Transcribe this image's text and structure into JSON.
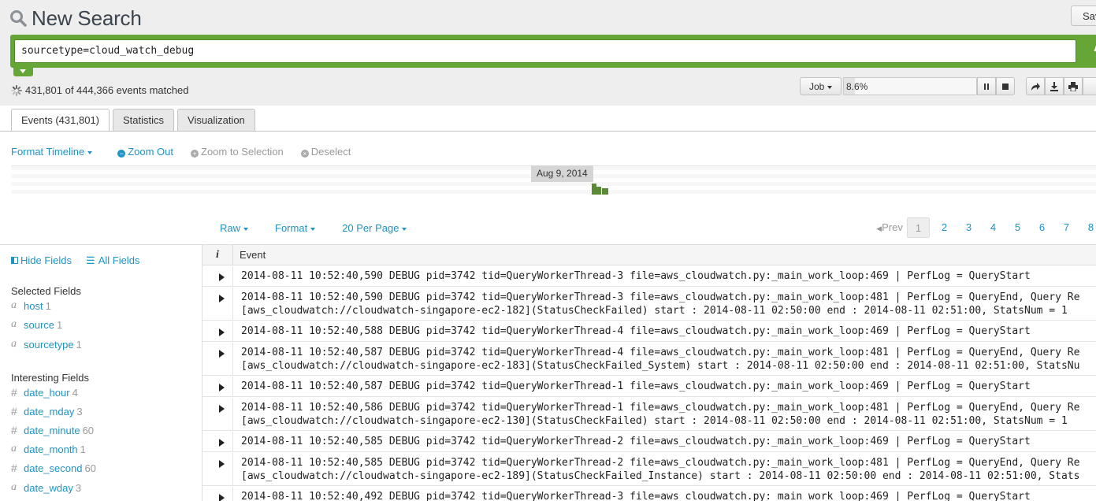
{
  "header": {
    "title": "New Search",
    "save_label": "Sav",
    "search_icon": "magnifier-icon"
  },
  "search": {
    "query": "sourcetype=cloud_watch_debug",
    "go_label": "A"
  },
  "status": {
    "matched_text": "431,801 of 444,366 events matched"
  },
  "job": {
    "label": "Job",
    "progress_text": "8.6%",
    "progress_fraction": 0.086,
    "controls": [
      "pause-icon",
      "stop-icon",
      "share-icon",
      "export-icon",
      "print-icon"
    ]
  },
  "tabs": [
    {
      "label": "Events (431,801)",
      "active": true
    },
    {
      "label": "Statistics",
      "active": false
    },
    {
      "label": "Visualization",
      "active": false
    }
  ],
  "timeline": {
    "format_label": "Format Timeline",
    "zoom_out": "Zoom Out",
    "zoom_selection": "Zoom to Selection",
    "deselect": "Deselect",
    "date_label": "Aug 9, 2014"
  },
  "results": {
    "raw_label": "Raw",
    "format_label": "Format",
    "per_page_label": "20 Per Page",
    "prev_label": "Prev",
    "pages": [
      "1",
      "2",
      "3",
      "4",
      "5",
      "6",
      "7",
      "8"
    ],
    "current_page": "1"
  },
  "sidebar": {
    "hide_fields": "Hide Fields",
    "all_fields": "All Fields",
    "selected_title": "Selected Fields",
    "selected_fields": [
      {
        "type": "a",
        "name": "host",
        "count": "1"
      },
      {
        "type": "a",
        "name": "source",
        "count": "1"
      },
      {
        "type": "a",
        "name": "sourcetype",
        "count": "1"
      }
    ],
    "interesting_title": "Interesting Fields",
    "interesting_fields": [
      {
        "type": "#",
        "name": "date_hour",
        "count": "4"
      },
      {
        "type": "#",
        "name": "date_mday",
        "count": "3"
      },
      {
        "type": "#",
        "name": "date_minute",
        "count": "60"
      },
      {
        "type": "a",
        "name": "date_month",
        "count": "1"
      },
      {
        "type": "#",
        "name": "date_second",
        "count": "60"
      },
      {
        "type": "a",
        "name": "date_wday",
        "count": "3"
      }
    ]
  },
  "events": {
    "info_header": "i",
    "event_header": "Event",
    "rows": [
      {
        "lines": [
          "2014-08-11 10:52:40,590 DEBUG pid=3742 tid=QueryWorkerThread-3 file=aws_cloudwatch.py:_main_work_loop:469 | PerfLog = QueryStart"
        ]
      },
      {
        "lines": [
          "2014-08-11 10:52:40,590 DEBUG pid=3742 tid=QueryWorkerThread-3 file=aws_cloudwatch.py:_main_work_loop:481 | PerfLog = QueryEnd, Query Re",
          "[aws_cloudwatch://cloudwatch-singapore-ec2-182](StatusCheckFailed) start : 2014-08-11 02:50:00 end : 2014-08-11 02:51:00, StatsNum = 1"
        ]
      },
      {
        "lines": [
          "2014-08-11 10:52:40,588 DEBUG pid=3742 tid=QueryWorkerThread-4 file=aws_cloudwatch.py:_main_work_loop:469 | PerfLog = QueryStart"
        ]
      },
      {
        "lines": [
          "2014-08-11 10:52:40,587 DEBUG pid=3742 tid=QueryWorkerThread-4 file=aws_cloudwatch.py:_main_work_loop:481 | PerfLog = QueryEnd, Query Re",
          "[aws_cloudwatch://cloudwatch-singapore-ec2-183](StatusCheckFailed_System) start : 2014-08-11 02:50:00 end : 2014-08-11 02:51:00, StatsNu"
        ]
      },
      {
        "lines": [
          "2014-08-11 10:52:40,587 DEBUG pid=3742 tid=QueryWorkerThread-1 file=aws_cloudwatch.py:_main_work_loop:469 | PerfLog = QueryStart"
        ]
      },
      {
        "lines": [
          "2014-08-11 10:52:40,586 DEBUG pid=3742 tid=QueryWorkerThread-1 file=aws_cloudwatch.py:_main_work_loop:481 | PerfLog = QueryEnd, Query Re",
          "[aws_cloudwatch://cloudwatch-singapore-ec2-130](StatusCheckFailed) start : 2014-08-11 02:50:00 end : 2014-08-11 02:51:00, StatsNum = 1"
        ]
      },
      {
        "lines": [
          "2014-08-11 10:52:40,585 DEBUG pid=3742 tid=QueryWorkerThread-2 file=aws_cloudwatch.py:_main_work_loop:469 | PerfLog = QueryStart"
        ]
      },
      {
        "lines": [
          "2014-08-11 10:52:40,585 DEBUG pid=3742 tid=QueryWorkerThread-2 file=aws_cloudwatch.py:_main_work_loop:481 | PerfLog = QueryEnd, Query Re",
          "[aws_cloudwatch://cloudwatch-singapore-ec2-189](StatusCheckFailed_Instance) start : 2014-08-11 02:50:00 end : 2014-08-11 02:51:00, Stats"
        ]
      },
      {
        "lines": [
          "2014-08-11 10:52:40,492 DEBUG pid=3742 tid=QueryWorkerThread-3 file=aws_cloudwatch.py:_main_work_loop:469 | PerfLog = QueryStart"
        ]
      }
    ]
  },
  "colors": {
    "accent_green": "#65a637",
    "link_blue": "#1e93c6",
    "histogram_bar": "#5a8a36"
  }
}
